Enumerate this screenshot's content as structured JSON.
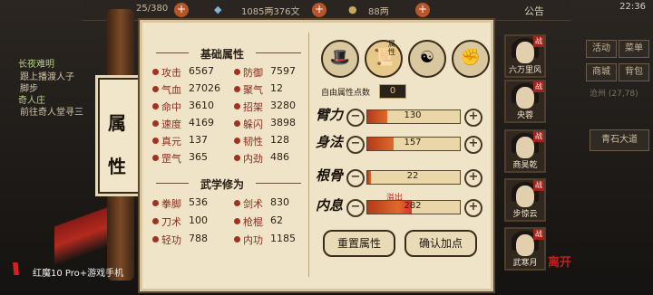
{
  "topbar": {
    "count": "25/380",
    "money": "1085两376文",
    "grain": "88两",
    "notice": "公告",
    "clock": "22:36"
  },
  "quests": [
    {
      "title": "长夜难明",
      "desc": "跟上播渡人子"
    },
    {
      "title": "",
      "desc": "脚步"
    },
    {
      "title": "奇人庄",
      "desc": "前往奇人堂寻三"
    }
  ],
  "right_menu": [
    "活动",
    "菜单",
    "商城",
    "背包",
    "地图",
    "设置"
  ],
  "location": "沧州 (27,78)",
  "blue_road": "青石大道",
  "scroll": {
    "title_1": "属",
    "title_2": "性"
  },
  "base_attrs": {
    "header": "基础属性",
    "rows": [
      [
        {
          "label": "攻击",
          "value": "6567"
        },
        {
          "label": "防御",
          "value": "7597"
        }
      ],
      [
        {
          "label": "气血",
          "value": "27026"
        },
        {
          "label": "聚气",
          "value": "12"
        }
      ],
      [
        {
          "label": "命中",
          "value": "3610"
        },
        {
          "label": "招架",
          "value": "3280"
        }
      ],
      [
        {
          "label": "速度",
          "value": "4169"
        },
        {
          "label": "躲闪",
          "value": "3898"
        }
      ],
      [
        {
          "label": "真元",
          "value": "137"
        },
        {
          "label": "韧性",
          "value": "128"
        }
      ],
      [
        {
          "label": "罡气",
          "value": "365"
        },
        {
          "label": "内劲",
          "value": "486"
        }
      ]
    ]
  },
  "martial": {
    "header": "武学修为",
    "rows": [
      [
        {
          "label": "拳脚",
          "value": "536"
        },
        {
          "label": "剑术",
          "value": "830"
        }
      ],
      [
        {
          "label": "刀术",
          "value": "100"
        },
        {
          "label": "枪棍",
          "value": "62"
        }
      ],
      [
        {
          "label": "轻功",
          "value": "788"
        },
        {
          "label": "内功",
          "value": "1185"
        }
      ]
    ]
  },
  "skill_icons": [
    "hat-icon",
    "scroll-attr-icon",
    "yinyang-icon",
    "flex-arm-icon"
  ],
  "skill_icon_tag": "属性",
  "free_points": {
    "label": "自由属性点数",
    "value": "0"
  },
  "attributes": [
    {
      "name": "臂力",
      "value": "130",
      "fill": 0.22
    },
    {
      "name": "身法",
      "value": "157",
      "fill": 0.28
    },
    {
      "name": "根骨",
      "value": "22",
      "fill": 0.04
    },
    {
      "name": "内息",
      "value": "282",
      "fill": 0.48
    }
  ],
  "overflow_label": "溢出",
  "buttons": {
    "reset": "重置属性",
    "confirm": "确认加点"
  },
  "party": [
    {
      "name": "六万里风",
      "tag": "战"
    },
    {
      "name": "央蓉",
      "tag": "战"
    },
    {
      "name": "商昊乾",
      "tag": "战"
    },
    {
      "name": "步惊云",
      "tag": "战"
    },
    {
      "name": "武寒月",
      "tag": "战"
    }
  ],
  "leave_label": "离开",
  "phone_badge": "红魔10 Pro+游戏手机"
}
